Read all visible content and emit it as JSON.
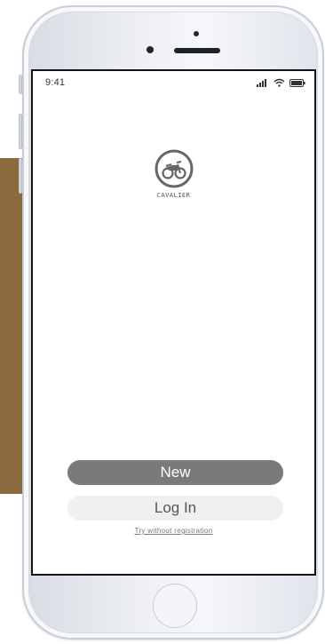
{
  "status_bar": {
    "time": "9:41",
    "icons": [
      "signal-icon",
      "wifi-icon",
      "battery-icon"
    ]
  },
  "logo": {
    "icon": "motorcycle-logo-icon",
    "text": "CAVALIER"
  },
  "buttons": {
    "new_label": "New",
    "login_label": "Log In"
  },
  "link": {
    "try_without_registration": "Try without registration"
  },
  "colors": {
    "background_band": "#8b6a3d",
    "new_button": "#7a7a7a",
    "login_button": "#f0f0f3"
  }
}
